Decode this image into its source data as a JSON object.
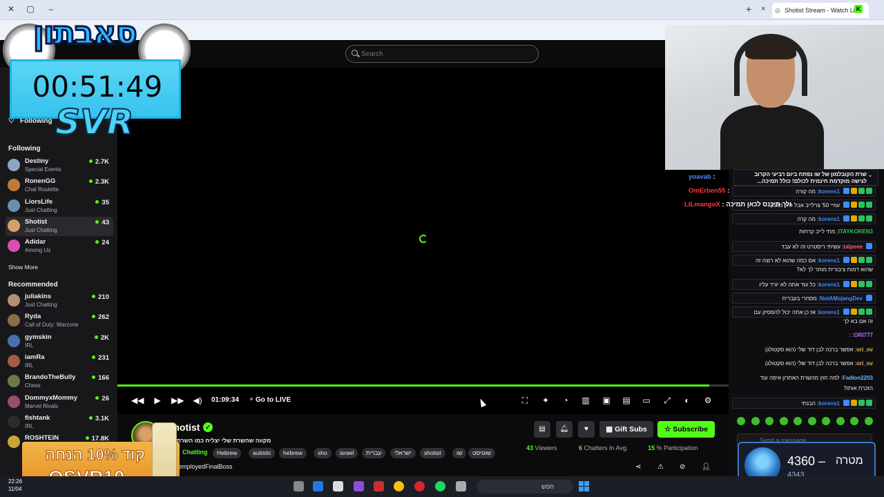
{
  "browser": {
    "tab_title": "Shotist Stream - Watch Live",
    "new_tab": "+",
    "close_tab": "×",
    "extension_badge": "K"
  },
  "header": {
    "search_placeholder": "Search"
  },
  "overlay": {
    "logo_text": "סאבתון",
    "timer": "00:51:49",
    "brand": "SVR"
  },
  "sidebar": {
    "following_button": "Following",
    "following_heading": "Following",
    "show_more": "Show More",
    "recommended_heading": "Recommended",
    "following": [
      {
        "name": "Destiny",
        "category": "Special Events",
        "viewers": "2.7K",
        "color": "#8da4c4"
      },
      {
        "name": "RonenGG",
        "category": "Chat Roulette",
        "viewers": "2.3K",
        "color": "#c07a3a"
      },
      {
        "name": "LiorsLife",
        "category": "Just Chatting",
        "viewers": "35",
        "color": "#6a8fb0"
      },
      {
        "name": "Shotist",
        "category": "Just Chatting",
        "viewers": "43",
        "color": "#d9a066"
      },
      {
        "name": "Adidar",
        "category": "Among Us",
        "viewers": "24",
        "color": "#d84fb4"
      }
    ],
    "recommended": [
      {
        "name": "juliakins",
        "category": "Just Chatting",
        "viewers": "210",
        "color": "#b68f73"
      },
      {
        "name": "Ryda",
        "category": "Call of Duty: Warzone",
        "viewers": "262",
        "color": "#8b6d4a"
      },
      {
        "name": "gymskin",
        "category": "IRL",
        "viewers": "2K",
        "color": "#4a6fb0"
      },
      {
        "name": "iamRa",
        "category": "IRL",
        "viewers": "231",
        "color": "#a35c4a"
      },
      {
        "name": "BrandoTheBully",
        "category": "Chess",
        "viewers": "166",
        "color": "#6b7a48"
      },
      {
        "name": "DommyxMommy",
        "category": "Marvel Rivals",
        "viewers": "26",
        "color": "#9b4d6e"
      },
      {
        "name": "fishtank",
        "category": "IRL",
        "viewers": "3.1K",
        "color": "#2b2b2b"
      },
      {
        "name": "ROSHTEIN",
        "category": "",
        "viewers": "17.8K",
        "color": "#c9a43a"
      }
    ]
  },
  "player": {
    "current_time": "01:09:34",
    "go_live": "Go to LIVE",
    "progress": 0.968,
    "icons": [
      "rewind-icon",
      "play-icon",
      "forward-icon",
      "volume-icon",
      "crop-icon",
      "sparkle-icon",
      "speed-icon",
      "stats-icon",
      "theater-icon",
      "clip-icon",
      "miniplayer-icon",
      "fullscreen-icon",
      "quality-icon",
      "settings-icon"
    ]
  },
  "stream": {
    "streamer": "Shotist",
    "verified_mark": "✓",
    "title": "מקווה שהשרת שלי יצליח כמו השרת הא",
    "category": "Chatting",
    "tags": [
      "Hebrew",
      "autistic",
      "hebrew",
      "sho",
      "israel",
      "עברית",
      "ישראלי",
      "shotist",
      "שו",
      "שוטיסט"
    ],
    "host_line": "employedFinalBoss",
    "gift_subs": "Gift Subs",
    "subscribe": "Subscribe",
    "viewers_value": "43",
    "viewers_label": "Viewers",
    "chatters_value": "6",
    "chatters_label": "Chatters In Avg.",
    "participation_value": "15",
    "participation_label": "% Participation"
  },
  "chat": {
    "pinned_line1": "שרת הקובלמון של שו נפתח ביום רביעי הקרוב",
    "pinned_line2": "לגישה מוקדמת חינמית לכולם! כולל תמיכה...",
    "overlay_messages": [
      {
        "user": "yoavab",
        "text": ":",
        "color": "#4e8cff"
      },
      {
        "user": "OmErben55",
        "text": ":",
        "color": "#ff3b3b"
      },
      {
        "user": "LILmangoX",
        "text": ": ולך תיכנס לכאן תמיכה",
        "color": "#ff3b3b"
      }
    ],
    "messages": [
      {
        "user": "korens1",
        "text": "מה קורה",
        "color": "#3d8cff",
        "badges": 4,
        "boxed": true
      },
      {
        "user": "",
        "text": "עוזיי 50' צרלייב אבל היה מוזמן",
        "color": "#efeff1",
        "badges": 4,
        "boxed": true
      },
      {
        "user": "korens1",
        "text": "מה קרה",
        "color": "#3d8cff",
        "badges": 4,
        "boxed": true
      },
      {
        "user": "ITAYKOREN3",
        "text": "מתי לייב קרחות",
        "color": "#2ec25a",
        "badges": 0,
        "boxed": false
      },
      {
        "user": "talpeee",
        "text": "עשיתי ריסטרט זה לא עבד",
        "color": "#ff5e5e",
        "badges": 1,
        "boxed": true
      },
      {
        "user": "korens1",
        "text": "אם כמה שהוא לא רוצה זה",
        "color": "#3d8cff",
        "badges": 4,
        "boxed": true
      },
      {
        "user": "",
        "text": "שהוא דמות ציבורית מותר לך לא?",
        "color": "#efeff1",
        "badges": 0,
        "boxed": false
      },
      {
        "user": "korens1",
        "text": "כל עוד אתה לא יורד עליו",
        "color": "#3d8cff",
        "badges": 4,
        "boxed": true
      },
      {
        "user": "NotAMojangDev",
        "text": "מסחרי בעברית",
        "color": "#4e8cff",
        "badges": 1,
        "boxed": true
      },
      {
        "user": "korens1",
        "text": "אז כן אתה יכול להפסיק עם",
        "color": "#3d8cff",
        "badges": 4,
        "boxed": true
      },
      {
        "user": "",
        "text": "זה אם בא לך",
        "color": "#efeff1",
        "badges": 0,
        "boxed": false
      },
      {
        "user": "ORI777",
        "text": ":",
        "color": "#b86bff",
        "badges": 0,
        "boxed": false
      },
      {
        "user": "ori_ov",
        "text": "אפשר ברכה לבן דוד שלי (הוא סקטולג)",
        "color": "#e0b84a",
        "badges": 0,
        "boxed": false
      },
      {
        "user": "ori_ov",
        "text": "אפשר ברכה לבן דוד שלי (הוא סקטולג)",
        "color": "#e0b84a",
        "badges": 0,
        "boxed": false
      },
      {
        "user": "Fadlon2203",
        "text": "למה חוץ מהשרת האחרון איפה עוד",
        "color": "#6bbcff",
        "badges": 0,
        "boxed": false
      },
      {
        "user": "",
        "text": "הזכרת אותו?",
        "color": "#efeff1",
        "badges": 0,
        "boxed": false
      },
      {
        "user": "korens1",
        "text": "הבנתי",
        "color": "#3d8cff",
        "badges": 4,
        "boxed": true
      }
    ],
    "input_placeholder": "Send a message"
  },
  "goal": {
    "current": "4360",
    "separator": "–",
    "label": "מטרה",
    "target": "4343"
  },
  "promo": {
    "line1": "קוד 10% הנחה",
    "line2": "OSVR10"
  },
  "taskbar": {
    "time": "22:26",
    "date": "11/04",
    "search_text": "חפש"
  }
}
